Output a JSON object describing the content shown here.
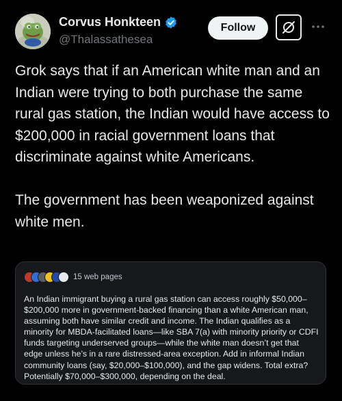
{
  "author": {
    "display_name": "Corvus Honkteen",
    "handle": "@Thalassathesea",
    "verified": true
  },
  "actions": {
    "follow_label": "Follow",
    "grok_icon": "grok-icon",
    "more_icon": "more-dots-icon"
  },
  "post": {
    "paragraphs": [
      "Grok says that if an American white man and an Indian were trying to both purchase the same rural gas station, the Indian would have access to $200,000 in racial government loans that discriminate against white Americans.",
      "The government has been weaponized against white men."
    ]
  },
  "grok_card": {
    "sources_label": "15 web pages",
    "answer": "An Indian immigrant buying a rural gas station can access roughly $50,000–$200,000 more in government-backed financing than a white American man, assuming both have similar credit and income. The Indian qualifies as a minority for MBDA-facilitated loans—like SBA 7(a) with minority priority or CDFI funds targeting underserved groups—while the white man doesn’t get that edge unless he’s in a rare distressed-area exception. Add in informal Indian community loans (say, $20,000–$100,000), and the gap widens. Total extra? Potentially $70,000–$300,000, depending on the deal."
  },
  "colors": {
    "background": "#000000",
    "text_primary": "#e7e9ea",
    "text_secondary": "#71767b",
    "verified_blue": "#1d9bf0",
    "card_background": "#16181c",
    "card_border": "#2f3336",
    "follow_button_bg": "#eff3f4"
  }
}
